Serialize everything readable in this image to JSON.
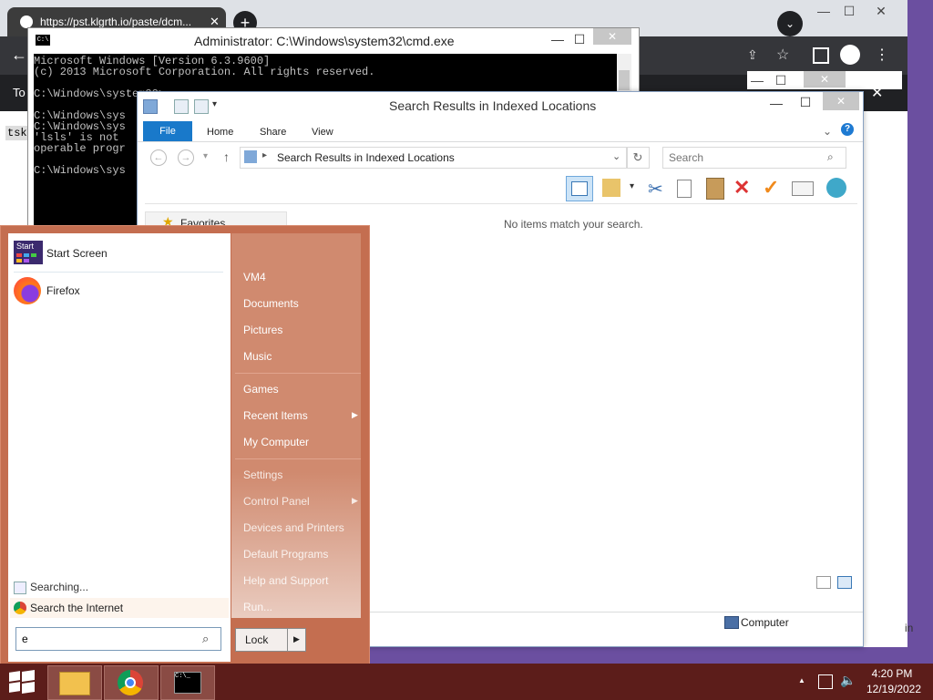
{
  "chrome": {
    "tab_url": "https://pst.klgrth.io/paste/dcm..."
  },
  "cmd": {
    "title": "Administrator: C:\\Windows\\system32\\cmd.exe",
    "icon_text": "C:\\",
    "lines": [
      "Microsoft Windows [Version 6.3.9600]",
      "(c) 2013 Microsoft Corporation. All rights reserved.",
      "",
      "C:\\Windows\\system32>",
      "",
      "C:\\Windows\\sys",
      "C:\\Windows\\sys",
      "'lsls' is not",
      "operable progr",
      "",
      "C:\\Windows\\sys"
    ]
  },
  "explorer": {
    "title": "Search Results in Indexed Locations",
    "tabs": [
      "File",
      "Home",
      "Share",
      "View"
    ],
    "address": "Search Results in Indexed Locations",
    "search_placeholder": "Search",
    "favorites_label": "Favorites",
    "empty_message": "No items match your search.",
    "status_computer": "Computer"
  },
  "start_menu": {
    "start_tile_label": "Start",
    "pinned": [
      {
        "label": "Start Screen"
      },
      {
        "label": "Firefox"
      }
    ],
    "search_status": "Searching...",
    "search_internet": "Search the Internet",
    "search_value": "e",
    "right_items_group1": [
      "VM4",
      "Documents",
      "Pictures",
      "Music"
    ],
    "right_items_group2": [
      "Games",
      "Recent Items",
      "My Computer"
    ],
    "right_items_group3": [
      "Settings",
      "Control Panel",
      "Devices and Printers",
      "Default Programs",
      "Help and Support",
      "Run..."
    ],
    "lock_label": "Lock"
  },
  "taskbar": {
    "time": "4:20 PM",
    "date": "12/19/2022",
    "cmd_icon_text": "C:\\_"
  },
  "colors": {
    "start_menu_bg": "#c46e50",
    "taskbar_bg": "#5c1d1a",
    "ribbon_file_tab": "#1979ca",
    "desktop": "#6b4fa0"
  }
}
